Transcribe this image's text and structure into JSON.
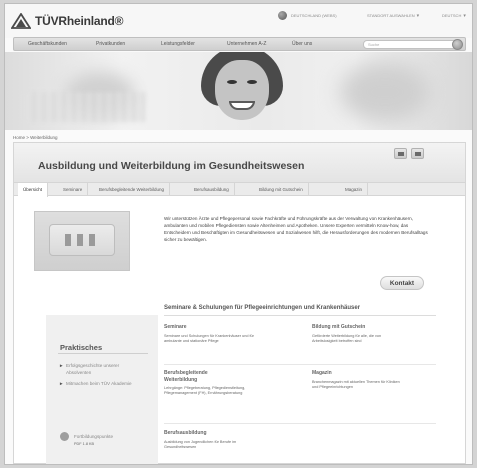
{
  "header": {
    "logo_text": "TÜVRheinland®",
    "country": "DEUTSCHLAND (WEBS)",
    "location": "STANDORT AUSWAHLEN",
    "lang": "DEUTSCH"
  },
  "nav": {
    "items": [
      "Geschäftskunden",
      "Privatkunden",
      "Leistungsfelder",
      "Unternehmen A-Z",
      "Über uns"
    ],
    "search_placeholder": "Suche"
  },
  "breadcrumb": "Home > Weiterbildung",
  "page": {
    "title": "Ausbildung und Weiterbildung im Gesundheitswesen",
    "tabs": [
      "Übersicht",
      "Seminare",
      "Berufsbegleitende Weiterbildung",
      "Berufsausbildung",
      "Bildung mit Gutschein",
      "Magazin"
    ],
    "intro": "Wir unterstützen Ärzte und Pflegepersonal sowie Fachkräfte und Führungskräfte aus der Verwaltung von Krankenhäusern, ambulanten und mobilen Pflegediensten sowie Altenheimen und Apotheken. Unsere Experten vermitteln Know-how, das Entscheidern und Beschäftigten im Gesundheitswesen und Sozialwesen hilft, die Herausforderungen des modernen Berufsalltags sicher zu bewältigen.",
    "kontakt": "Kontakt"
  },
  "sidebar": {
    "title": "Praktisches",
    "links": [
      "Erfolgsgeschichte unserer Absolventen",
      "Mitmachen beim TÜV Akademie"
    ],
    "fb_label": "Fortbildungspunkte",
    "fb_code": "PDF 1.8 KB"
  },
  "seminars": {
    "heading": "Seminare & Schulungen für Pflegeeinrichtungen und Krankenhäuser",
    "items": [
      {
        "title": "Seminare",
        "desc": "Seminare und Schulungen für Krankenhäuser und für ambulante und stationäre Pflege"
      },
      {
        "title": "Bildung mit Gutschein",
        "desc": "Geförderte Weiterbildung für alle, die von Arbeitslosigkeit betroffen sind"
      },
      {
        "title": "Berufsbegleitende Weiterbildung",
        "desc": "Lehrgänge: Pflegeberatung, Pflegedienstleitung, Pflegemanagement (FH), Ernährungsberatung"
      },
      {
        "title": "Magazin",
        "desc": "Branchenmagazin mit aktuellen Themen für Kliniken und Pflegeeinrichtungen"
      },
      {
        "title": "Berufsausbildung",
        "desc": "Ausbildung von Jugendlichen für Berufe im Gesundheitswesen"
      }
    ]
  }
}
